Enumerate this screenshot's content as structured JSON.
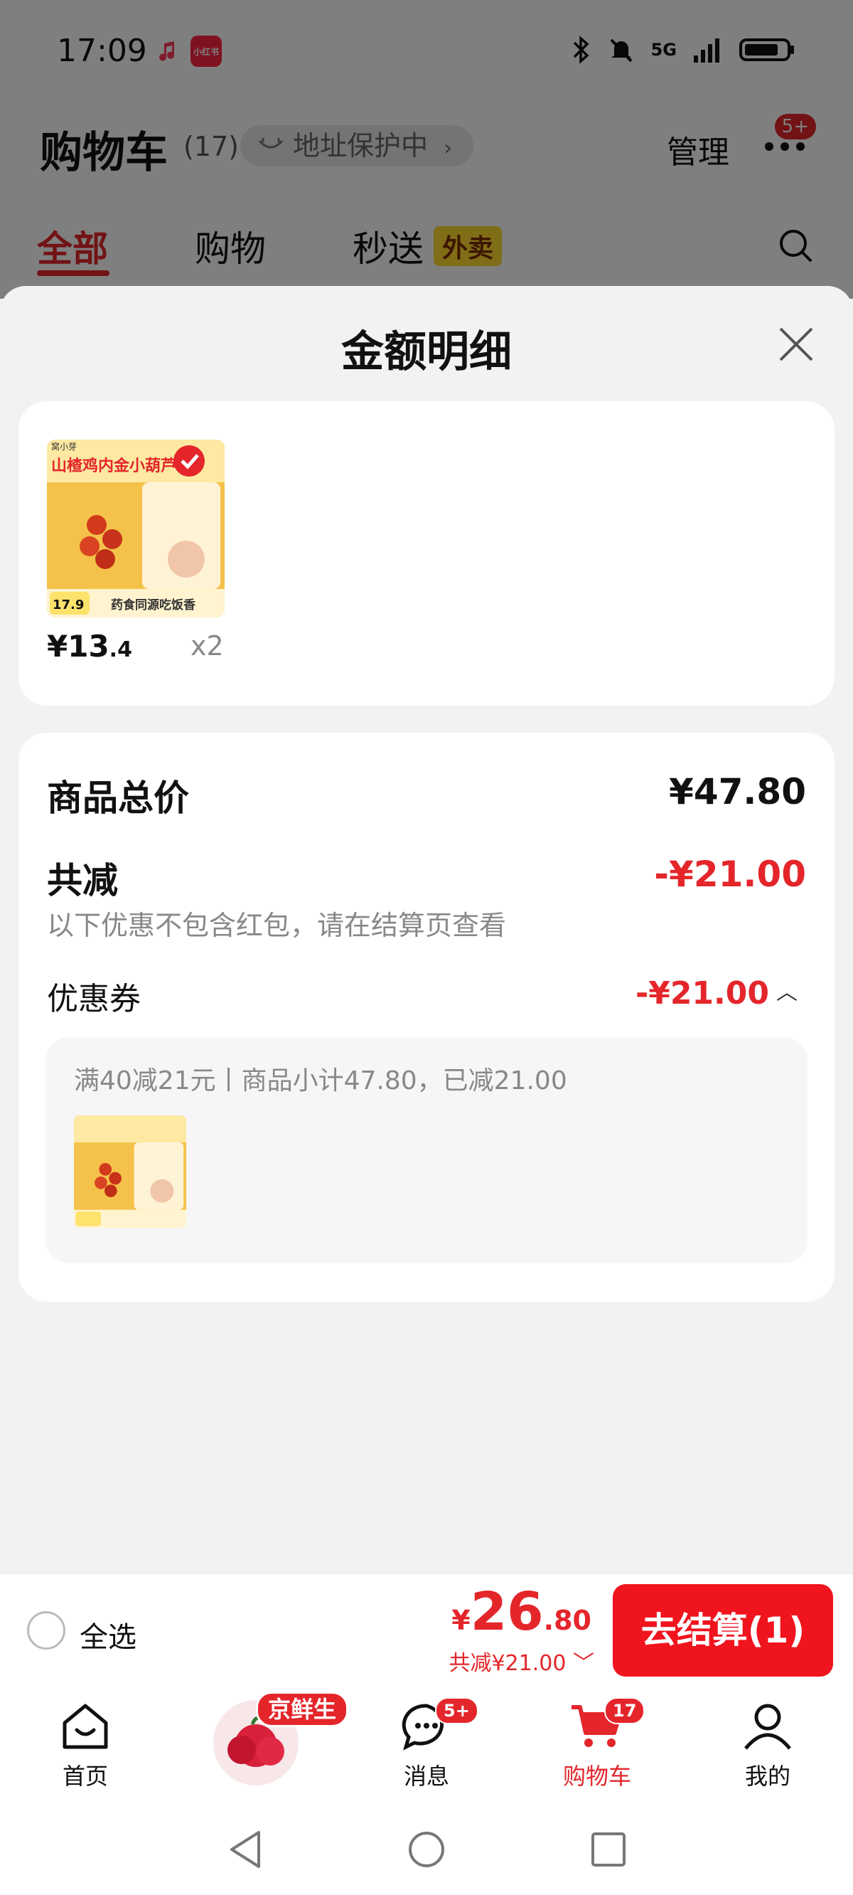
{
  "status_bar": {
    "time": "17:09",
    "xhs_label": "小红书",
    "network": "5G"
  },
  "header": {
    "title": "购物车",
    "count": "(17)",
    "address_protection": "地址保护中",
    "manage": "管理",
    "more_badge": "5+"
  },
  "tabs": [
    {
      "label": "全部",
      "active": true
    },
    {
      "label": "购物"
    },
    {
      "label": "秒送",
      "tag": "外卖"
    }
  ],
  "sheet": {
    "title": "金额明细",
    "product": {
      "price_int": "¥13",
      "price_dec": ".4",
      "qty": "x2"
    },
    "detail": {
      "goods_total_label": "商品总价",
      "goods_total_value": "¥47.80",
      "discount_label": "共减",
      "discount_value": "-¥21.00",
      "note": "以下优惠不包含红包，请在结算页查看",
      "coupon_label": "优惠券",
      "coupon_value": "-¥21.00",
      "coupon_desc": "满40减21元丨商品小计47.80，已减21.00"
    }
  },
  "checkout": {
    "select_all": "全选",
    "currency": "¥",
    "total_int": "26",
    "total_dec": ".80",
    "saved": "共减¥21.00",
    "button": "去结算(1)"
  },
  "tabbar": {
    "home": "首页",
    "fresh_tag": "京鲜生",
    "messages": "消息",
    "messages_badge": "5+",
    "cart": "购物车",
    "cart_badge": "17",
    "mine": "我的"
  },
  "colors": {
    "accent": "#e4262b",
    "button": "#f0141e",
    "takeout_tag": "#ffdb2e"
  },
  "product_image_text": {
    "brand": "窝小芽",
    "headline": "山楂鸡内金小葫芦",
    "footer": "药食同源吃饭香",
    "price_tag": "17.9"
  }
}
